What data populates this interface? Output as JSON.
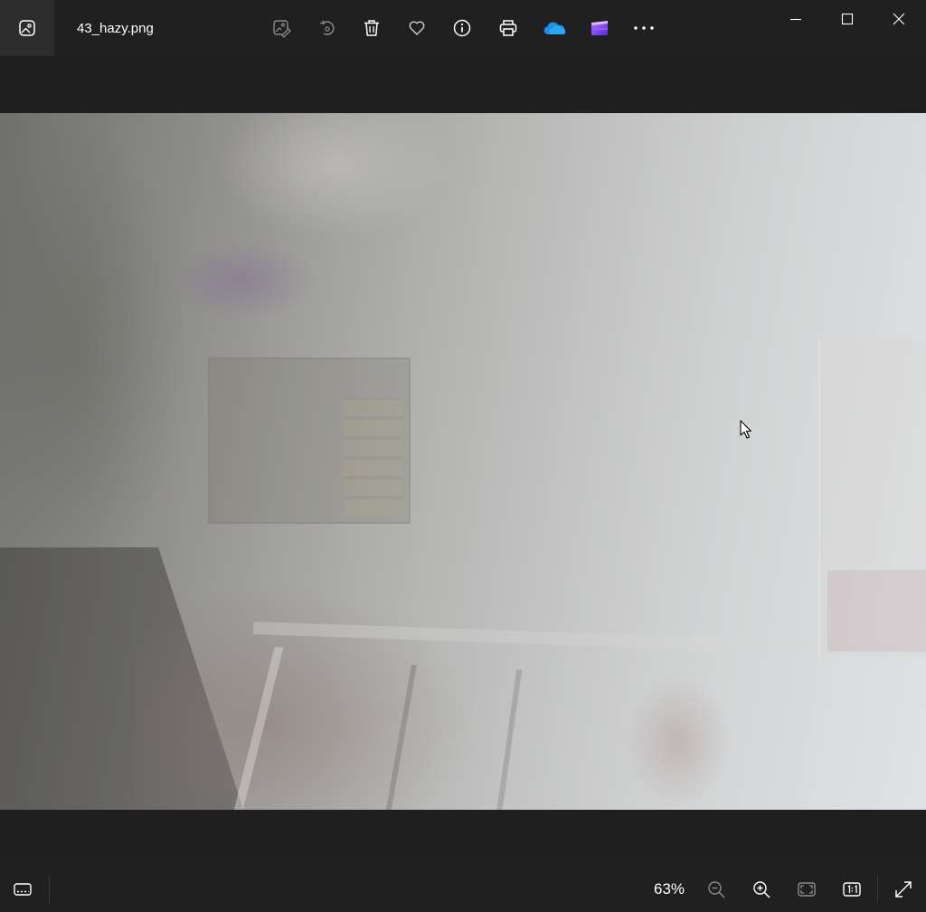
{
  "window": {
    "file_name": "43_hazy.png"
  },
  "toolbar": {
    "items": [
      {
        "name": "edit-image",
        "icon": "edit-image-icon"
      },
      {
        "name": "rotate",
        "icon": "rotate-icon"
      },
      {
        "name": "delete",
        "icon": "trash-icon"
      },
      {
        "name": "favorite",
        "icon": "heart-icon"
      },
      {
        "name": "file-info",
        "icon": "info-icon"
      },
      {
        "name": "print",
        "icon": "printer-icon"
      },
      {
        "name": "onedrive",
        "icon": "cloud-icon"
      },
      {
        "name": "clipchamp",
        "icon": "clipchamp-icon"
      },
      {
        "name": "more",
        "icon": "more-icon"
      }
    ]
  },
  "window_controls": [
    "minimize",
    "maximize",
    "close"
  ],
  "viewer": {
    "zoom_level": "63%"
  },
  "colors": {
    "background": "#1f1f1f",
    "titlebar": "#202020",
    "onedrive_blue": "#1e8fe1",
    "clipchamp_purple": "#7b3ff2"
  }
}
